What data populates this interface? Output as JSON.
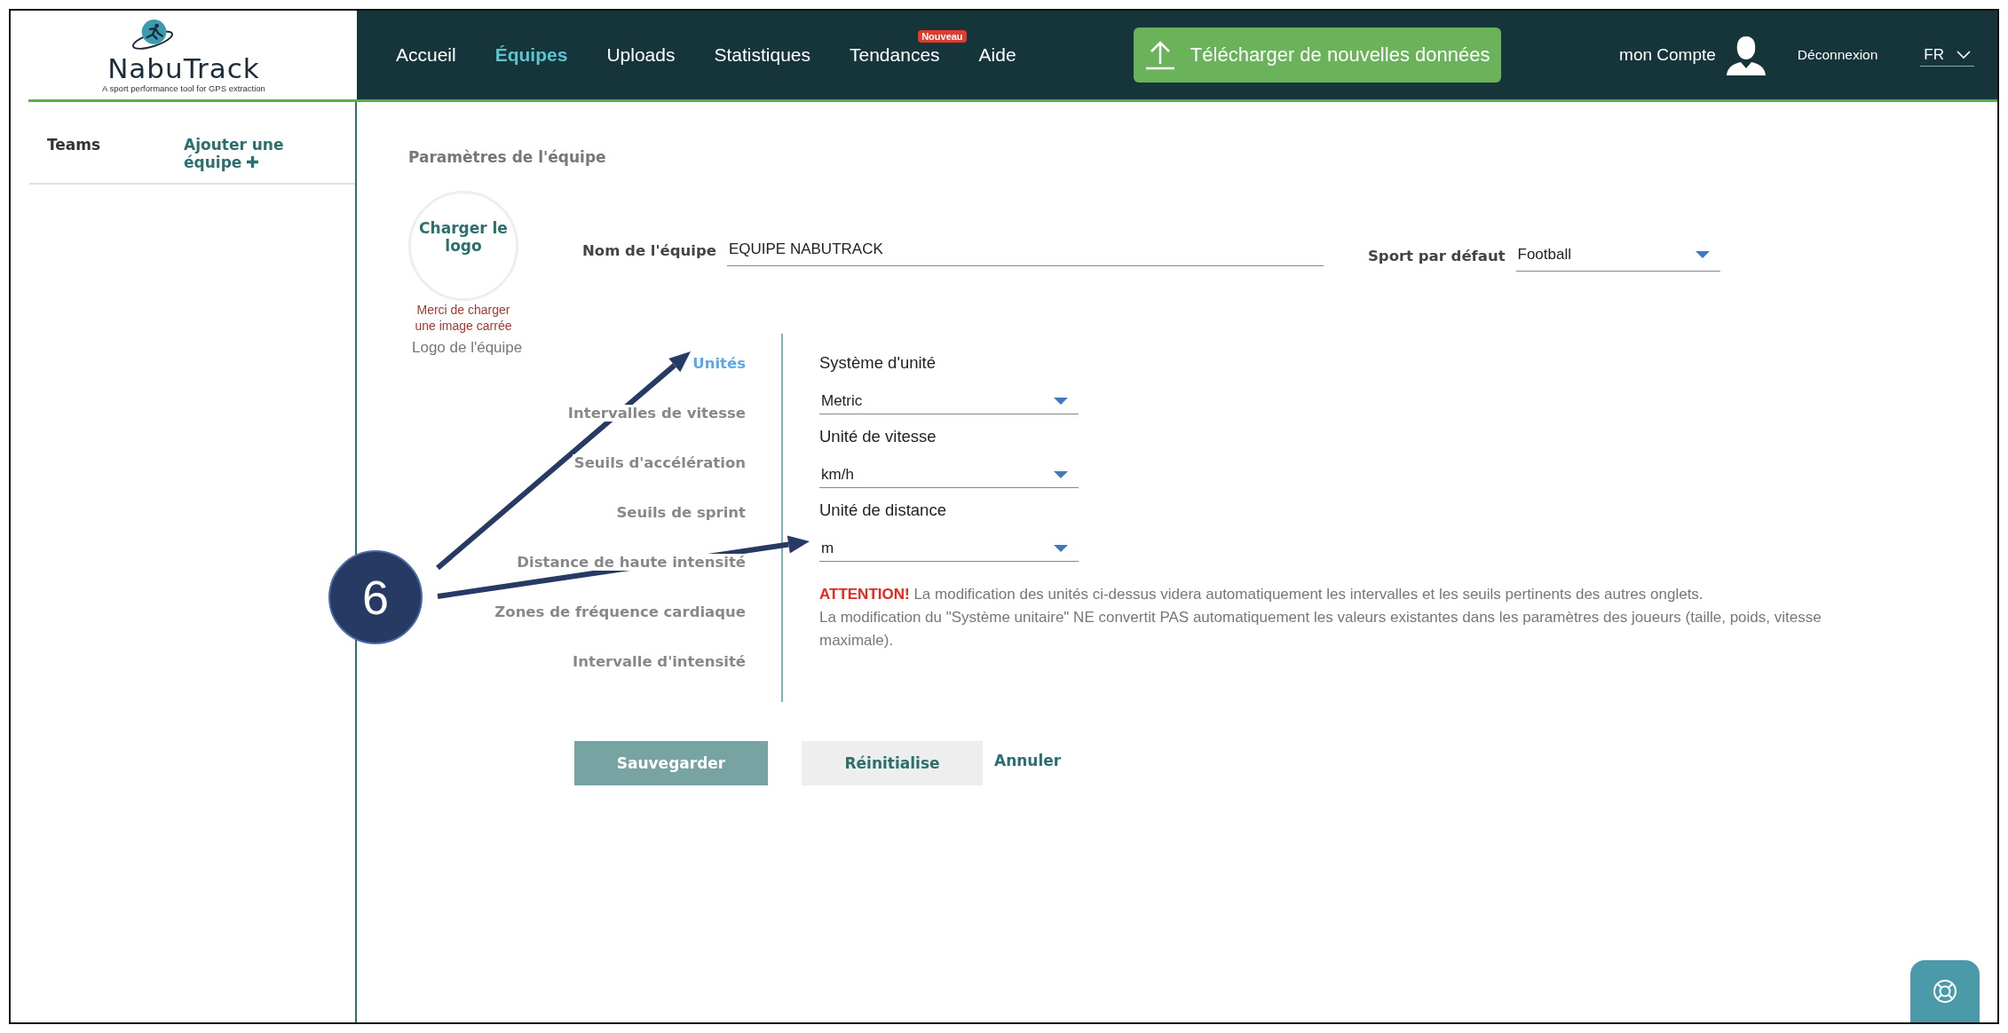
{
  "brand": {
    "name": "NabuTrack",
    "tagline": "A sport performance tool for GPS extraction"
  },
  "nav": [
    {
      "label": "Accueil",
      "selected": false
    },
    {
      "label": "Équipes",
      "selected": true
    },
    {
      "label": "Uploads",
      "selected": false
    },
    {
      "label": "Statistiques",
      "selected": false
    },
    {
      "label": "Tendances",
      "selected": false,
      "badge": "Nouveau"
    },
    {
      "label": "Aide",
      "selected": false
    }
  ],
  "upload_button": "Télécharger de nouvelles données",
  "account": {
    "label": "mon Compte",
    "logout": "Déconnexion",
    "language": "FR"
  },
  "sidebar": {
    "title": "Teams",
    "add_link": "Ajouter une équipe"
  },
  "page_title": "Paramètres de l'équipe",
  "logo_upload": {
    "button": "Charger le logo",
    "hint": "Merci de charger une image carrée",
    "caption": "Logo de l'équipe"
  },
  "team_name": {
    "label": "Nom de l'équipe",
    "value": "EQUIPE NABUTRACK"
  },
  "default_sport": {
    "label": "Sport par défaut",
    "value": "Football"
  },
  "settings_tabs": [
    {
      "label": "Unités",
      "selected": true
    },
    {
      "label": "Intervalles de vitesse",
      "selected": false
    },
    {
      "label": "Seuils d'accélération",
      "selected": false
    },
    {
      "label": "Seuils de sprint",
      "selected": false
    },
    {
      "label": "Distance de haute intensité",
      "selected": false
    },
    {
      "label": "Zones de fréquence cardiaque",
      "selected": false
    },
    {
      "label": "Intervalle d'intensité",
      "selected": false
    }
  ],
  "unit_fields": [
    {
      "label": "Système d'unité",
      "value": "Metric"
    },
    {
      "label": "Unité de vitesse",
      "value": "km/h"
    },
    {
      "label": "Unité de distance",
      "value": "m"
    }
  ],
  "warning": [
    "**ATTENTION!** La modification des unités ci-dessus videra automatiquement les intervalles et les seuils pertinents des autres onglets.",
    "La modification du \"Système unitaire\" NE convertit PAS automatiquement les valeurs existantes dans les paramètres des joueurs (taille, poids, vitesse maximale)."
  ],
  "actions": [
    {
      "kind": "primary",
      "label": "Sauvegarder"
    },
    {
      "kind": "secondary",
      "label": "Réinitialise"
    },
    {
      "kind": "link",
      "label": "Annuler"
    }
  ],
  "annotation": {
    "label": "6"
  }
}
